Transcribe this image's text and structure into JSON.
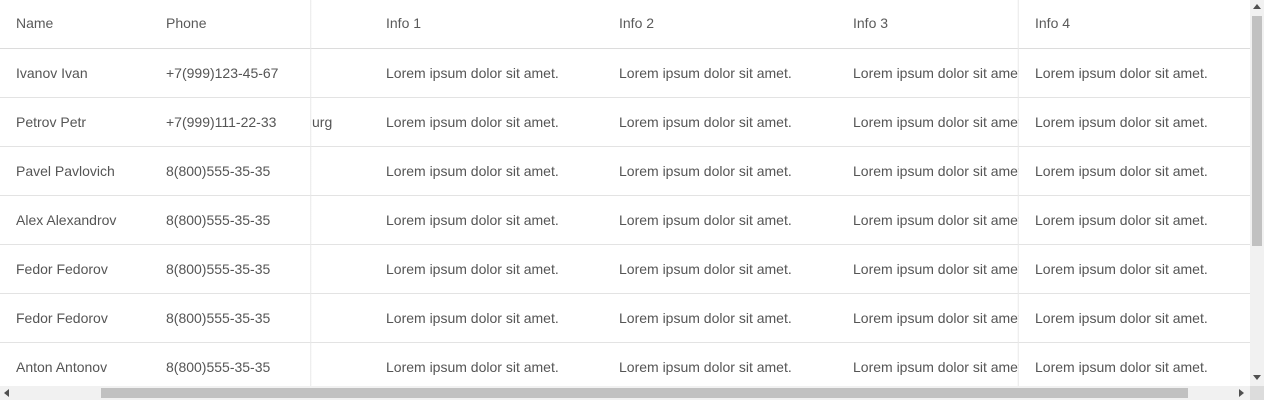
{
  "columns": {
    "name": "Name",
    "phone": "Phone",
    "info1": "Info 1",
    "info2": "Info 2",
    "info3": "Info 3",
    "info4": "Info 4"
  },
  "rows": [
    {
      "name": "Ivanov Ivan",
      "phone": "+7(999)123-45-67",
      "city": "",
      "info1": "Lorem ipsum dolor sit amet.",
      "info2": "Lorem ipsum dolor sit amet.",
      "info3": "Lorem ipsum dolor sit amet.",
      "info4": "Lorem ipsum dolor sit amet."
    },
    {
      "name": "Petrov Petr",
      "phone": "+7(999)111-22-33",
      "city": "urg",
      "info1": "Lorem ipsum dolor sit amet.",
      "info2": "Lorem ipsum dolor sit amet.",
      "info3": "Lorem ipsum dolor sit amet.",
      "info4": "Lorem ipsum dolor sit amet."
    },
    {
      "name": "Pavel Pavlovich",
      "phone": "8(800)555-35-35",
      "city": "",
      "info1": "Lorem ipsum dolor sit amet.",
      "info2": "Lorem ipsum dolor sit amet.",
      "info3": "Lorem ipsum dolor sit amet.",
      "info4": "Lorem ipsum dolor sit amet."
    },
    {
      "name": "Alex Alexandrov",
      "phone": "8(800)555-35-35",
      "city": "",
      "info1": "Lorem ipsum dolor sit amet.",
      "info2": "Lorem ipsum dolor sit amet.",
      "info3": "Lorem ipsum dolor sit amet.",
      "info4": "Lorem ipsum dolor sit amet."
    },
    {
      "name": "Fedor Fedorov",
      "phone": "8(800)555-35-35",
      "city": "",
      "info1": "Lorem ipsum dolor sit amet.",
      "info2": "Lorem ipsum dolor sit amet.",
      "info3": "Lorem ipsum dolor sit amet.",
      "info4": "Lorem ipsum dolor sit amet."
    },
    {
      "name": "Fedor Fedorov",
      "phone": "8(800)555-35-35",
      "city": "",
      "info1": "Lorem ipsum dolor sit amet.",
      "info2": "Lorem ipsum dolor sit amet.",
      "info3": "Lorem ipsum dolor sit amet.",
      "info4": "Lorem ipsum dolor sit amet."
    },
    {
      "name": "Anton Antonov",
      "phone": "8(800)555-35-35",
      "city": "",
      "info1": "Lorem ipsum dolor sit amet.",
      "info2": "Lorem ipsum dolor sit amet.",
      "info3": "Lorem ipsum dolor sit amet.",
      "info4": "Lorem ipsum dolor sit amet."
    }
  ],
  "icons": {
    "scroll_up": "chevron-up-icon",
    "scroll_down": "chevron-down-icon",
    "scroll_left": "chevron-left-icon",
    "scroll_right": "chevron-right-icon"
  },
  "colors": {
    "text": "#555555",
    "border": "#e3e3e3",
    "scroll_track": "#f1f1f1",
    "scroll_thumb": "#c1c1c1"
  }
}
